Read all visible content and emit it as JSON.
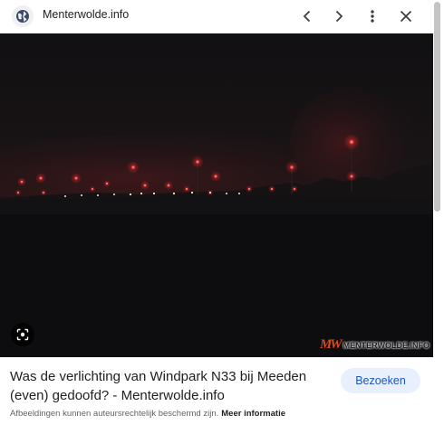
{
  "header": {
    "site_name": "Menterwolde.info",
    "site_icon": "globe-icon",
    "prev_icon": "chevron-left-icon",
    "next_icon": "chevron-right-icon",
    "more_icon": "more-vert-icon",
    "close_icon": "close-icon"
  },
  "image": {
    "watermark_logo": "MW",
    "watermark_text": "MENTERWOLDE.INFO",
    "lens_icon": "lens-icon"
  },
  "result": {
    "title": "Was de verlichting van Windpark N33 bij Meeden (even) gedoofd? - Menterwolde.info",
    "visit_label": "Bezoeken",
    "copyright_text": "Afbeeldingen kunnen auteursrechtelijk beschermd zijn.",
    "more_info_label": "Meer informatie"
  },
  "colors": {
    "accent": "#1a56c4",
    "visit_bg": "#e8f0fe",
    "warning_light": "#ff3b3b",
    "sky": "#161416",
    "watermark": "#d94a1a"
  }
}
